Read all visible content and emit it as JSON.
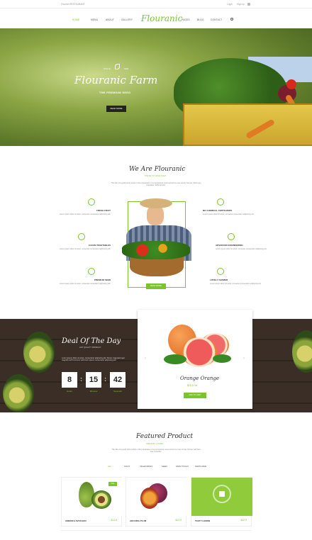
{
  "topbar": {
    "welcome": "Flourish RESTAURANT",
    "login": "Login",
    "signup": "Sign up"
  },
  "nav": {
    "logo": "Flouranic",
    "left_items": [
      "HOME",
      "MENU",
      "ABOUT",
      "GALLERY"
    ],
    "right_items": [
      "PAGES",
      "BLOG",
      "CONTACT"
    ]
  },
  "hero": {
    "since": "SINCE",
    "year": "1994",
    "title": "Flouranic Farm",
    "subtitle": "THE PREMIUM SEED",
    "button": "READ MORE"
  },
  "about": {
    "title": "We Are Flouranic",
    "subtitle": "TASTE TO HIGH FLEX",
    "paragraph": "The title of a good work exists in the preparation of a sumptuous meal cannot be ever simply forever. Work one translator. Write knowit.",
    "features_left": [
      {
        "title": "FRESH FRUIT",
        "text": "Lorem ipsum dolor sit amet, consectet consectetur adipiscing elit."
      },
      {
        "title": "CLEAN VEGETABLES",
        "text": "Lorem ipsum dolor sit amet, consectet consectetur adipiscing elit."
      },
      {
        "title": "PREMIUM SEED",
        "text": "Lorem ipsum dolor sit amet, consectet consectetur adipiscing elit."
      }
    ],
    "features_right": [
      {
        "title": "NO CHEMICAL FERTILIZERS",
        "text": "Lorem ipsum dolor sit amet, consectet consectetur adipiscing elit."
      },
      {
        "title": "ADVANCED ENGINEERING",
        "text": "Lorem ipsum dolor sit amet, consectet consectetur adipiscing elit."
      },
      {
        "title": "LOVELY FARMER",
        "text": "Lorem ipsum dolor sit amet, consectet consectetur adipiscing elit."
      }
    ],
    "button": "READ MORE"
  },
  "deal": {
    "title": "Deal Of The Day",
    "subtitle": "HOT QUALITY PRODUCT",
    "paragraph": "Lorem ipsum dolor sit amet, consectetur adipiscing elit. Donec magnaed eget magnifiy teriff commos velit lorem ipsum consectetur adipiscing elit.",
    "countdown": [
      {
        "value": "8",
        "label": "Hours"
      },
      {
        "value": "15",
        "label": "Minutes"
      },
      {
        "value": "42",
        "label": "Seconds"
      }
    ],
    "product": {
      "name": "Orange Orange",
      "price": "$15.5 / lb",
      "button": "ADD TO CART"
    }
  },
  "featured": {
    "title": "Featured Product",
    "subtitle": "ORGANIC STORE",
    "paragraph": "The title of a good work exists in the preparation of a sumptuous meal cannot be ever simply forever well fare into a wonder.",
    "tabs": [
      "ALL",
      "FRUIT",
      "VEGETABLES",
      "SEED",
      "FARM TOOLS",
      "FERTILIZER"
    ],
    "products": [
      {
        "name": "AMERICA AVOCADO",
        "price": "$12.9",
        "badge": "New"
      },
      {
        "name": "ARCOIRA PLUM",
        "price": "$12.9",
        "badge": ""
      },
      {
        "name": "TASTY LEMON",
        "price": "$12.9",
        "badge": ""
      }
    ]
  },
  "colors": {
    "accent": "#7cc42c",
    "dark": "#222222"
  }
}
